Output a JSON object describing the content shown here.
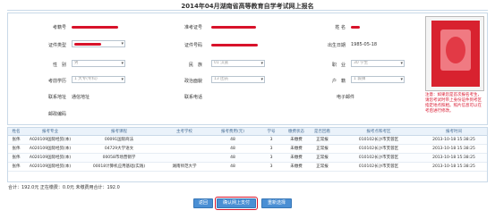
{
  "page": {
    "title": "2014年04月湖南省高等教育自学考试网上报名"
  },
  "colors": {
    "accent_blue": "#4a8fd4",
    "highlight_red": "#d8122a",
    "grid_header": "#eaf2fa"
  },
  "form": {
    "row1": {
      "exam_no_label": "考籍号",
      "student_no_label": "准考证号",
      "name_label": "姓 名"
    },
    "row2": {
      "id_type_label": "证件类型",
      "id_no_label": "证件号码",
      "birth_label": "出生日期",
      "birth_value": "1985-05-18"
    },
    "row3": {
      "gender_label": "性　别",
      "gender_value": "男",
      "ethnicity_label": "民　族",
      "ethnicity_value": "01 汉族",
      "occupation_label": "职　业",
      "occupation_value": "30 学生"
    },
    "row4": {
      "education_label": "考前学历",
      "education_value": "1 大专(专科)",
      "politics_label": "政治面貌",
      "politics_value": "13 团员",
      "hukou_label": "户　籍",
      "hukou_value": "1 城镇"
    },
    "row5": {
      "address_label": "联系地址",
      "address_value": "通信地址",
      "phone_label": "联系电话",
      "email_label": "电子邮件"
    },
    "row6": {
      "postcode_label": "邮政编码"
    }
  },
  "photo": {
    "note": "注意：如果您是首次报名考生，请您考试时带上身份证件到考区指定地点照相。照片信息可以在考后进行修改。"
  },
  "grid": {
    "headers": [
      "姓名",
      "报考专业",
      "报考课程",
      "主考学校",
      "报考费用(元)",
      "学号",
      "缴费状态",
      "是否回看",
      "报考点和考区",
      "报考时间"
    ],
    "rows": [
      [
        "张伟",
        "A020109国际经贸(本)",
        "00091国际商法",
        "",
        "48",
        "3",
        "未缴费",
        "正常报",
        "010102长沙市芙蓉区",
        "2013-10-18 15:38:25"
      ],
      [
        "张伟",
        "A020109国际经贸(本)",
        "04729大学语文",
        "",
        "48",
        "3",
        "未缴费",
        "正常报",
        "010102长沙市芙蓉区",
        "2013-10-18 15:38:25"
      ],
      [
        "张伟",
        "A020109国际经贸(本)",
        "00058市场营销学",
        "",
        "48",
        "3",
        "未缴费",
        "正常报",
        "010102长沙市芙蓉区",
        "2013-10-18 15:38:25"
      ],
      [
        "张伟",
        "A020109国际经贸(本)",
        "00018计算机应用基础(实践)",
        "湖南师范大学",
        "48",
        "3",
        "未缴费",
        "正常报",
        "010102长沙市芙蓉区",
        "2013-10-18 15:38:25"
      ]
    ]
  },
  "summary": {
    "text": "合计：192.0元 正在缴费：0.0元 未缴费用合计：192.0"
  },
  "buttons": {
    "back_label": "返回",
    "submit_label": "确认网上支付",
    "reselect_label": "重新选择"
  }
}
